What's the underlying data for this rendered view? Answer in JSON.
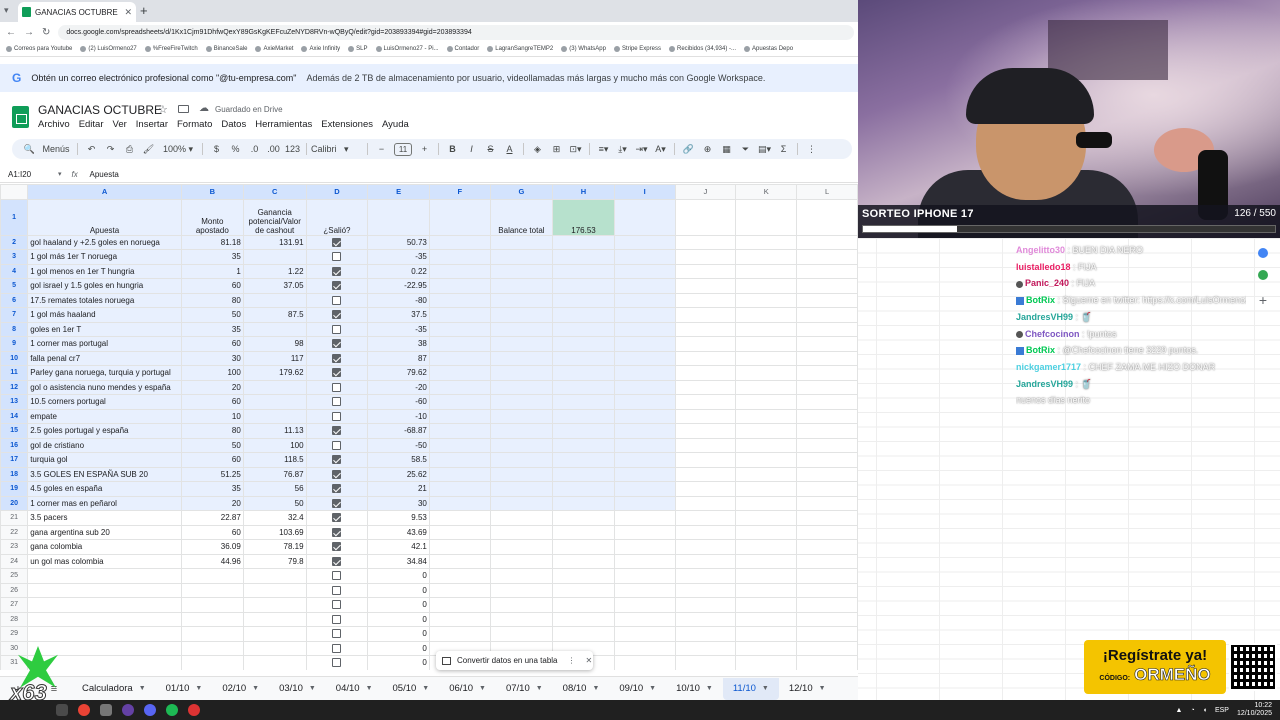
{
  "browser": {
    "tab_title": "GANACIAS OCTUBRE - Hojas de",
    "url": "docs.google.com/spreadsheets/d/1Kx1Cjm91DhfwQexY89GsKgKEFcuZeNYD8RVn-wQByQ/edit?gid=203893394#gid=203893394",
    "bookmarks": [
      "Correos para Youtube",
      "(2) LuisOrmeno27",
      "%FreeFireTwitch",
      "BinanceSale",
      "AxieMarket",
      "Axie Infinity",
      "SLP",
      "LuisOrmeno27 - Pi...",
      "Contador",
      "LagranSangreTEMP2",
      "(3) WhatsApp",
      "Stripe Express",
      "Recibidos (34,934) -...",
      "Apuestas Depo"
    ]
  },
  "promo_banner": {
    "text": "Obtén un correo electrónico profesional como \"@tu-empresa.com\"",
    "subtext": "Además de 2 TB de almacenamiento por usuario, videollamadas más largas y mucho más con Google Workspace."
  },
  "doc": {
    "title": "GANACIAS OCTUBRE",
    "saved_status": "Guardado en Drive",
    "menu": [
      "Archivo",
      "Editar",
      "Ver",
      "Insertar",
      "Formato",
      "Datos",
      "Herramientas",
      "Extensiones",
      "Ayuda"
    ]
  },
  "toolbar": {
    "menus_label": "Menús",
    "zoom": "100%",
    "currency": "$",
    "percent": "%",
    "dec_down": ".0",
    "dec_up": ".00",
    "format_123": "123",
    "font": "Calibri",
    "font_size": "11"
  },
  "formula_bar": {
    "cell_ref": "A1:I20",
    "value": "Apuesta"
  },
  "sheet": {
    "columns": [
      "A",
      "B",
      "C",
      "D",
      "E",
      "F",
      "G",
      "H",
      "I",
      "J",
      "K",
      "L"
    ],
    "headers": {
      "a": "Apuesta",
      "b": "Monto apostado",
      "c": "Ganancia potencial/Valor de cashout",
      "d": "¿Salió?"
    },
    "balance_label": "Balance total",
    "balance_value": "176.53",
    "rows": [
      {
        "n": "2",
        "a": "gol haaland y +2.5 goles en noruega",
        "b": "81.18",
        "c": "131.91",
        "d": true,
        "e": "50.73"
      },
      {
        "n": "3",
        "a": "1 gol más 1er T noruega",
        "b": "35",
        "c": "",
        "d": false,
        "e": "-35"
      },
      {
        "n": "4",
        "a": "1 gol menos en 1er T hungria",
        "b": "1",
        "c": "1.22",
        "d": true,
        "e": "0.22"
      },
      {
        "n": "5",
        "a": "gol israel y 1.5 goles en hungria",
        "b": "60",
        "c": "37.05",
        "d": true,
        "e": "-22.95"
      },
      {
        "n": "6",
        "a": "17.5 remates totales noruega",
        "b": "80",
        "c": "",
        "d": false,
        "e": "-80"
      },
      {
        "n": "7",
        "a": "1 gol más haaland",
        "b": "50",
        "c": "87.5",
        "d": true,
        "e": "37.5"
      },
      {
        "n": "8",
        "a": "goles en 1er T",
        "b": "35",
        "c": "",
        "d": false,
        "e": "-35"
      },
      {
        "n": "9",
        "a": "1 corner mas portugal",
        "b": "60",
        "c": "98",
        "d": true,
        "e": "38"
      },
      {
        "n": "10",
        "a": "falla penal cr7",
        "b": "30",
        "c": "117",
        "d": true,
        "e": "87"
      },
      {
        "n": "11",
        "a": "Parley gana noruega, turquia y portugal",
        "b": "100",
        "c": "179.62",
        "d": true,
        "e": "79.62"
      },
      {
        "n": "12",
        "a": "gol o asistencia nuno mendes y españa",
        "b": "20",
        "c": "",
        "d": false,
        "e": "-20"
      },
      {
        "n": "13",
        "a": "10.5 corners portugal",
        "b": "60",
        "c": "",
        "d": false,
        "e": "-60"
      },
      {
        "n": "14",
        "a": "empate",
        "b": "10",
        "c": "",
        "d": false,
        "e": "-10"
      },
      {
        "n": "15",
        "a": "2.5 goles portugal y españa",
        "b": "80",
        "c": "11.13",
        "d": true,
        "e": "-68.87"
      },
      {
        "n": "16",
        "a": "gol de cristiano",
        "b": "50",
        "c": "100",
        "d": false,
        "e": "-50"
      },
      {
        "n": "17",
        "a": "turquia gol",
        "b": "60",
        "c": "118.5",
        "d": true,
        "e": "58.5"
      },
      {
        "n": "18",
        "a": "3.5 GOLES EN ESPAÑA SUB 20",
        "b": "51.25",
        "c": "76.87",
        "d": true,
        "e": "25.62"
      },
      {
        "n": "19",
        "a": "4.5 goles en españa",
        "b": "35",
        "c": "56",
        "d": true,
        "e": "21"
      },
      {
        "n": "20",
        "a": "1 corner mas en peñarol",
        "b": "20",
        "c": "50",
        "d": true,
        "e": "30"
      },
      {
        "n": "21",
        "a": "3.5 pacers",
        "b": "22.87",
        "c": "32.4",
        "d": true,
        "e": "9.53"
      },
      {
        "n": "22",
        "a": "gana argentina sub 20",
        "b": "60",
        "c": "103.69",
        "d": true,
        "e": "43.69"
      },
      {
        "n": "23",
        "a": "gana colombia",
        "b": "36.09",
        "c": "78.19",
        "d": true,
        "e": "42.1"
      },
      {
        "n": "24",
        "a": "un gol mas colombia",
        "b": "44.96",
        "c": "79.8",
        "d": true,
        "e": "34.84"
      },
      {
        "n": "25",
        "a": "",
        "b": "",
        "c": "",
        "d": false,
        "e": "0"
      },
      {
        "n": "26",
        "a": "",
        "b": "",
        "c": "",
        "d": false,
        "e": "0"
      },
      {
        "n": "27",
        "a": "",
        "b": "",
        "c": "",
        "d": false,
        "e": "0"
      },
      {
        "n": "28",
        "a": "",
        "b": "",
        "c": "",
        "d": false,
        "e": "0"
      },
      {
        "n": "29",
        "a": "",
        "b": "",
        "c": "",
        "d": false,
        "e": "0"
      },
      {
        "n": "30",
        "a": "",
        "b": "",
        "c": "",
        "d": false,
        "e": "0"
      },
      {
        "n": "31",
        "a": "",
        "b": "",
        "c": "",
        "d": false,
        "e": "0"
      }
    ]
  },
  "convert_tip": {
    "label": "Convertir datos en una tabla"
  },
  "sheet_tabs": [
    "Calculadora",
    "01/10",
    "02/10",
    "03/10",
    "04/10",
    "05/10",
    "06/10",
    "07/10",
    "08/10",
    "09/10",
    "10/10",
    "11/10",
    "12/10"
  ],
  "active_sheet_tab": "11/10",
  "stream": {
    "sorteo_title": "SORTEO IPHONE 17",
    "sorteo_count": "126 / 550",
    "sorteo_progress": 0.229,
    "chat": [
      {
        "user": "Angelitto30",
        "msg": "BUEN DIA NERO",
        "color": "#e08ad9",
        "kind": "plain"
      },
      {
        "user": "luistalledo18",
        "msg": "FIJA",
        "color": "#e91e63",
        "kind": "plain"
      },
      {
        "user": "Panic_240",
        "msg": "FIJA",
        "color": "#c2185b",
        "kind": "badge"
      },
      {
        "user": "BotRix",
        "msg": "Sígueme en twitter: https://x.com/LuisOrmeno27",
        "color": "#00c853",
        "kind": "bot"
      },
      {
        "user": "JandresVH99",
        "msg": "🥤",
        "color": "#26a69a",
        "kind": "plain"
      },
      {
        "user": "Chefcocinon",
        "msg": "!puntos",
        "color": "#7e57c2",
        "kind": "badge"
      },
      {
        "user": "BotRix",
        "msg": "@Chefcocinon tiene 3229 puntos.",
        "color": "#00c853",
        "kind": "bot"
      },
      {
        "user": "nickgamer1717",
        "msg": "CHEF ZAMA ME HIZO DONAR",
        "color": "#4dd0e1",
        "kind": "plain"
      },
      {
        "user": "JandresVH99",
        "msg": "🥤",
        "color": "#26a69a",
        "kind": "plain"
      },
      {
        "user": "",
        "msg": "nuenos días nerito",
        "color": "#ffffff",
        "kind": "plain"
      }
    ],
    "promo_ad_line1": "¡Regístrate ya!",
    "promo_ad_code_label": "CÓDIGO:",
    "promo_ad_code": "ORMEÑO",
    "logo_text": "x63"
  },
  "taskbar": {
    "lang": "ESP",
    "time": "10:22",
    "date": "12/10/2025"
  }
}
